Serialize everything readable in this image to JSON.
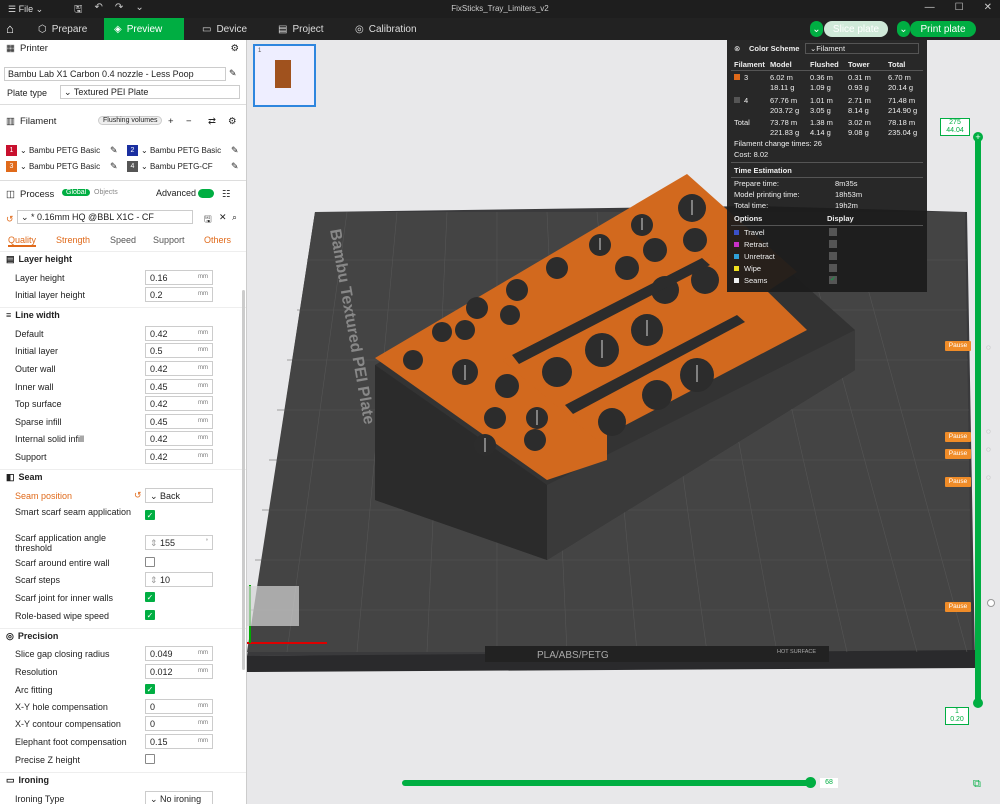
{
  "window": {
    "file_menu": "File",
    "title": "FixSticks_Tray_Limiters_v2"
  },
  "nav": {
    "tabs": [
      {
        "label": "Prepare",
        "icon": "cube-icon"
      },
      {
        "label": "Preview",
        "icon": "layers-icon"
      },
      {
        "label": "Device",
        "icon": "device-icon"
      },
      {
        "label": "Project",
        "icon": "project-icon"
      },
      {
        "label": "Calibration",
        "icon": "calibration-icon"
      }
    ],
    "active_tab": "Preview",
    "slice_label": "Slice plate",
    "print_label": "Print plate"
  },
  "printer": {
    "section": "Printer",
    "name": "Bambu Lab X1 Carbon 0.4 nozzle - Less Poop",
    "plate_type_label": "Plate type",
    "plate_type": "Textured PEI Plate"
  },
  "filament": {
    "section": "Filament",
    "flushing_label": "Flushing volumes",
    "slots": [
      {
        "num": "1",
        "name": "Bambu PETG Basic",
        "color": "#c8102e"
      },
      {
        "num": "2",
        "name": "Bambu PETG Basic",
        "color": "#1a2fa0"
      },
      {
        "num": "3",
        "name": "Bambu PETG Basic",
        "color": "#e06a1a"
      },
      {
        "num": "4",
        "name": "Bambu PETG-CF",
        "color": "#555555"
      }
    ]
  },
  "process": {
    "section": "Process",
    "global_label": "Global",
    "objects_label": "Objects",
    "advanced_label": "Advanced",
    "preset": "* 0.16mm HQ @BBL X1C - CF",
    "tabs": [
      "Quality",
      "Strength",
      "Speed",
      "Support",
      "Others"
    ]
  },
  "settings": {
    "layer_height_group": "Layer height",
    "layer_height": {
      "label": "Layer height",
      "value": "0.16",
      "unit": "mm"
    },
    "initial_layer_height": {
      "label": "Initial layer height",
      "value": "0.2",
      "unit": "mm"
    },
    "line_width_group": "Line width",
    "lw_default": {
      "label": "Default",
      "value": "0.42",
      "unit": "mm"
    },
    "lw_initial": {
      "label": "Initial layer",
      "value": "0.5",
      "unit": "mm"
    },
    "lw_outer": {
      "label": "Outer wall",
      "value": "0.42",
      "unit": "mm"
    },
    "lw_inner": {
      "label": "Inner wall",
      "value": "0.45",
      "unit": "mm"
    },
    "lw_top": {
      "label": "Top surface",
      "value": "0.42",
      "unit": "mm"
    },
    "lw_sparse": {
      "label": "Sparse infill",
      "value": "0.45",
      "unit": "mm"
    },
    "lw_internal": {
      "label": "Internal solid infill",
      "value": "0.42",
      "unit": "mm"
    },
    "lw_support": {
      "label": "Support",
      "value": "0.42",
      "unit": "mm"
    },
    "seam_group": "Seam",
    "seam_position": {
      "label": "Seam position",
      "value": "Back"
    },
    "smart_scarf": {
      "label": "Smart scarf seam application",
      "checked": true
    },
    "scarf_angle": {
      "label": "Scarf application angle threshold",
      "value": "155",
      "unit": "°"
    },
    "scarf_entire": {
      "label": "Scarf around entire wall",
      "checked": false
    },
    "scarf_steps": {
      "label": "Scarf steps",
      "value": "10"
    },
    "scarf_inner": {
      "label": "Scarf joint for inner walls",
      "checked": true
    },
    "role_wipe": {
      "label": "Role-based wipe speed",
      "checked": true
    },
    "precision_group": "Precision",
    "slice_gap": {
      "label": "Slice gap closing radius",
      "value": "0.049",
      "unit": "mm"
    },
    "resolution": {
      "label": "Resolution",
      "value": "0.012",
      "unit": "mm"
    },
    "arc_fitting": {
      "label": "Arc fitting",
      "checked": true
    },
    "xy_hole": {
      "label": "X-Y hole compensation",
      "value": "0",
      "unit": "mm"
    },
    "xy_contour": {
      "label": "X-Y contour compensation",
      "value": "0",
      "unit": "mm"
    },
    "elephant": {
      "label": "Elephant foot compensation",
      "value": "0.15",
      "unit": "mm"
    },
    "precise_z": {
      "label": "Precise Z height",
      "checked": false
    },
    "ironing_group": "Ironing",
    "ironing_type": {
      "label": "Ironing Type",
      "value": "No ironing"
    }
  },
  "legend": {
    "color_scheme_label": "Color Scheme",
    "color_scheme": "Filament",
    "headers": [
      "Filament",
      "Model",
      "Flushed",
      "Tower",
      "Total"
    ],
    "rows": [
      {
        "id": "3",
        "color": "#e06a1a",
        "model": [
          "6.02 m",
          "18.11 g"
        ],
        "flushed": [
          "0.36 m",
          "1.09 g"
        ],
        "tower": [
          "0.31 m",
          "0.93 g"
        ],
        "total": [
          "6.70 m",
          "20.14 g"
        ]
      },
      {
        "id": "4",
        "color": "#555555",
        "model": [
          "67.76 m",
          "203.72 g"
        ],
        "flushed": [
          "1.01 m",
          "3.05 g"
        ],
        "tower": [
          "2.71 m",
          "8.14 g"
        ],
        "total": [
          "71.48 m",
          "214.90 g"
        ]
      }
    ],
    "total": {
      "label": "Total",
      "model": [
        "73.78 m",
        "221.83 g"
      ],
      "flushed": [
        "1.38 m",
        "4.14 g"
      ],
      "tower": [
        "3.02 m",
        "9.08 g"
      ],
      "total": [
        "78.18 m",
        "235.04 g"
      ]
    },
    "change_times": "Filament change times:  26",
    "cost": "Cost:  8.02",
    "time_label": "Time Estimation",
    "prepare": {
      "label": "Prepare time:",
      "value": "8m35s"
    },
    "model_time": {
      "label": "Model printing time:",
      "value": "18h53m"
    },
    "total_time": {
      "label": "Total time:",
      "value": "19h2m"
    },
    "options_label": "Options",
    "display_label": "Display",
    "options": [
      {
        "name": "Travel",
        "color": "#3a50c8",
        "on": false
      },
      {
        "name": "Retract",
        "color": "#c830c8",
        "on": false
      },
      {
        "name": "Unretract",
        "color": "#30a0d8",
        "on": false
      },
      {
        "name": "Wipe",
        "color": "#f0e020",
        "on": false
      },
      {
        "name": "Seams",
        "color": "#f0f0f0",
        "on": true
      }
    ]
  },
  "bed": {
    "plate_text": "Bambu Textured PEI Plate",
    "bed_label": "PLA/ABS/PETG",
    "hot_label": "HOT SURFACE"
  },
  "slider": {
    "top_layer": "275",
    "top_height": "44.04",
    "bottom_layer": "1",
    "bottom_height": "0.20",
    "h_value": "68",
    "pause": "Pause",
    "pause_positions": [
      0.37,
      0.53,
      0.56,
      0.61,
      0.83
    ]
  }
}
